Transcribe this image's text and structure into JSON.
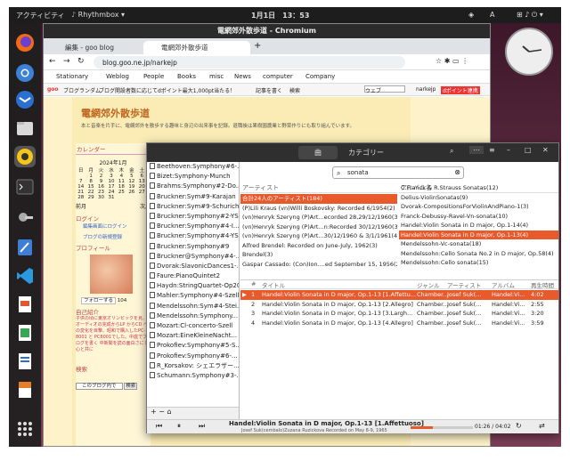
{
  "topbar": {
    "activities": "アクティビティ",
    "app": "Rhythmbox",
    "clock": "1月1日　13：53",
    "lang": "A"
  },
  "chrome": {
    "window_title": "電網郊外散歩道 - Chromium",
    "tabs": [
      {
        "label": "編集 - goo blog"
      },
      {
        "label": "電網郊外散歩道"
      }
    ],
    "url": "blog.goo.ne.jp/narkejp",
    "bookmarks": [
      "Stationary",
      "Weblog",
      "People",
      "Books",
      "misc",
      "News",
      "computer",
      "Company"
    ],
    "goobar": {
      "logo": "goo",
      "items": [
        "ブログ",
        "ランダム",
        "ブログ開設者数に応じてdポイント最大1,000pt当たる！",
        "記事を書く",
        "検索"
      ],
      "search_option": "ウェブ",
      "user": "narkejp",
      "points": "dポイント連携"
    }
  },
  "blog": {
    "title": "電網郊外散歩道",
    "subtitle": "本と音楽を片手に、電網郊外を散歩する趣味と身辺の出来事を記録。退職後は果樹園農業と野菜作りにも取り組んでいます。",
    "calendar_heading": "カレンダー",
    "month": "2024年1月",
    "weekdays": [
      "日",
      "月",
      "火",
      "水",
      "木",
      "金",
      "土"
    ],
    "days": [
      [
        "",
        "1",
        "2",
        "3",
        "4",
        "5",
        "6"
      ],
      [
        "7",
        "8",
        "9",
        "10",
        "11",
        "12",
        "13"
      ],
      [
        "14",
        "15",
        "16",
        "17",
        "18",
        "19",
        "20"
      ],
      [
        "21",
        "22",
        "23",
        "24",
        "25",
        "26",
        "27"
      ],
      [
        "28",
        "29",
        "30",
        "31",
        "",
        "",
        ""
      ]
    ],
    "nav_prev": "前月",
    "nav_next": "次月",
    "login_heading": "ログイン",
    "login_link": "編集画面にログイン",
    "new_blog": "ブログの新規登録",
    "profile_heading": "プロフィール",
    "follow": "フォローする",
    "follow_count": "104",
    "intro_heading": "自己紹介",
    "intro_text": "子供の頃に東京オリンピックを見、オーディオの完成からLP からCD への変化を目撃、昭和で購入したPC-8001 と PC8001でした。中庭でブログを書く 中新聞を読の面白さに 関心と共に",
    "search_heading": "検索",
    "search_option": "このブログ内で",
    "search_button": "検索"
  },
  "rb": {
    "view_tabs": [
      "曲",
      "カテゴリー"
    ],
    "search": "sonata",
    "playlists": [
      "Beethoven:Symphony#6-...",
      "Bizet:Symphony-Munch",
      "Brahms:Symphony#2-Do...",
      "Bruckner:Sym#9-Karajan",
      "Bruckner:Sym#9-Schuricht",
      "Bruckner:Symphony#2-YSO",
      "Bruckner:Symphony#4-I...",
      "Bruckner:Symphony#4-YSO",
      "Bruckner:Symphony#9",
      "Bruckner@Symphony#4-...",
      "Dvorak:SlavonicDances1-...",
      "Faure:PianoQuintet2",
      "Haydn:StringQuartet-Op20",
      "Mahler:Symphony#4-Szell",
      "Mendelssohn:Sym#4-Stei...",
      "Mendelssohn:Symphony...",
      "Mozart:Cl-concerto-Szell",
      "Mozart:EineKleineNacht...",
      "Prokofiev:Symphony#5-S...",
      "Prokofiev:Symphony#6-...",
      "R_Korsakov: シェエラザー...",
      "Schumann:Symphony#3-..."
    ],
    "artist_header": "アーティスト",
    "album_header": "アルバム名",
    "artists": [
      "合計24人のアーティスト(184)",
      "(P)Lili Kraus (vn)Willi Boskovsky: Recorded 6/1954(2)",
      "(vn)Henryk Szeryng (P)Art...ecorded 28,29/12/1960(3)",
      "(vn)Henryk Szeryng (P)Art...n:Recorded 30/12/1960(3)",
      "(vn)Henryk Szeryng (P)Art...30/12/1960 & 3/1/1961(4)",
      "Alfred Brendel: Recorded on June-July, 1962(3)",
      "Brendel(3)",
      "Gaspar Cassado: (Con)Ion....ed September 15, 1956(2)"
    ],
    "albums": [
      "C.Franck & R.Strauss Sonatas(12)",
      "Delius-ViolinSonatas(9)",
      "Dvorak-CompositionsForViolinAndPiano-1(3)",
      "Franck-Debussy-Ravel-Vn-sonata(10)",
      "Handel:Violin Sonata in D major, Op.1-14(4)",
      "Handel:Violin Sonata in D major, Op.1-13(4)",
      "Mendelssohn-Vc-sonata(18)",
      "Mendelssohn:Cello Sonata No.2 in D major, Op.58(4)",
      "Mendelssohn:Cello sonata(15)"
    ],
    "track_headers": [
      "#",
      "タイトル",
      "ジャンル",
      "アーティスト",
      "アルバム",
      "再生時間"
    ],
    "tracks": [
      {
        "n": "1",
        "title": "Handel:Violin Sonata in D major, Op.1-13 [1.Affettu...",
        "genre": "Chamber...",
        "artist": "Josef Suk(...",
        "album": "Handel:Vi...",
        "time": "4:02"
      },
      {
        "n": "2",
        "title": "Handel:Violin Sonata in D major, Op.1-13 [2.Allegro]",
        "genre": "Chamber...",
        "artist": "Josef Suk(...",
        "album": "Handel:Vi...",
        "time": "2:55"
      },
      {
        "n": "3",
        "title": "Handel:Violin Sonata in D major, Op.1-13 [3.Largh...",
        "genre": "Chamber...",
        "artist": "Josef Suk(...",
        "album": "Handel:Vi...",
        "time": "3:20"
      },
      {
        "n": "4",
        "title": "Handel:Violin Sonata in D major, Op.1-13 [4.Allegro]",
        "genre": "Chamber...",
        "artist": "Josef Suk(...",
        "album": "Handel:Vi...",
        "time": "3:59"
      }
    ],
    "now_title": "Handel:Violin Sonata in D major, Op.1-13 [1.Affettuoso]",
    "now_sub": "Josef Suk(cembalo)Zuzana Ruzickova Recorded on May 8-9, 1965",
    "time": "01:26 / 04:02",
    "progress": 0.36
  }
}
